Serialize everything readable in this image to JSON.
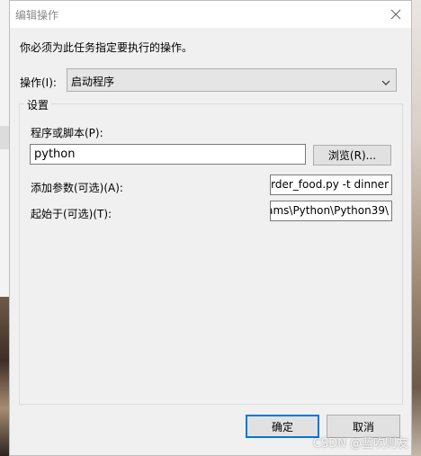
{
  "dialog": {
    "title": "编辑操作",
    "instruction": "你必须为此任务指定要执行的操作。",
    "action": {
      "label": "操作(I):",
      "value": "启动程序"
    },
    "settings": {
      "group_label": "设置",
      "program": {
        "label": "程序或脚本(P):",
        "value": "python",
        "browse_label": "浏览(R)..."
      },
      "arguments": {
        "label": "添加参数(可选)(A):",
        "value": "rder_food.py -t dinner"
      },
      "start_in": {
        "label": "起始于(可选)(T):",
        "value": "ams\\Python\\Python39\\"
      }
    },
    "ok_label": "确定",
    "cancel_label": "取消"
  },
  "watermark": "CSDN @蓝吹则友",
  "colors": {
    "dialog_bg": "#f0f0f0",
    "focus_border": "#0078d7",
    "title_text": "#8a8a8a"
  },
  "icons": {
    "close": "close-icon",
    "dropdown": "chevron-down-icon"
  }
}
